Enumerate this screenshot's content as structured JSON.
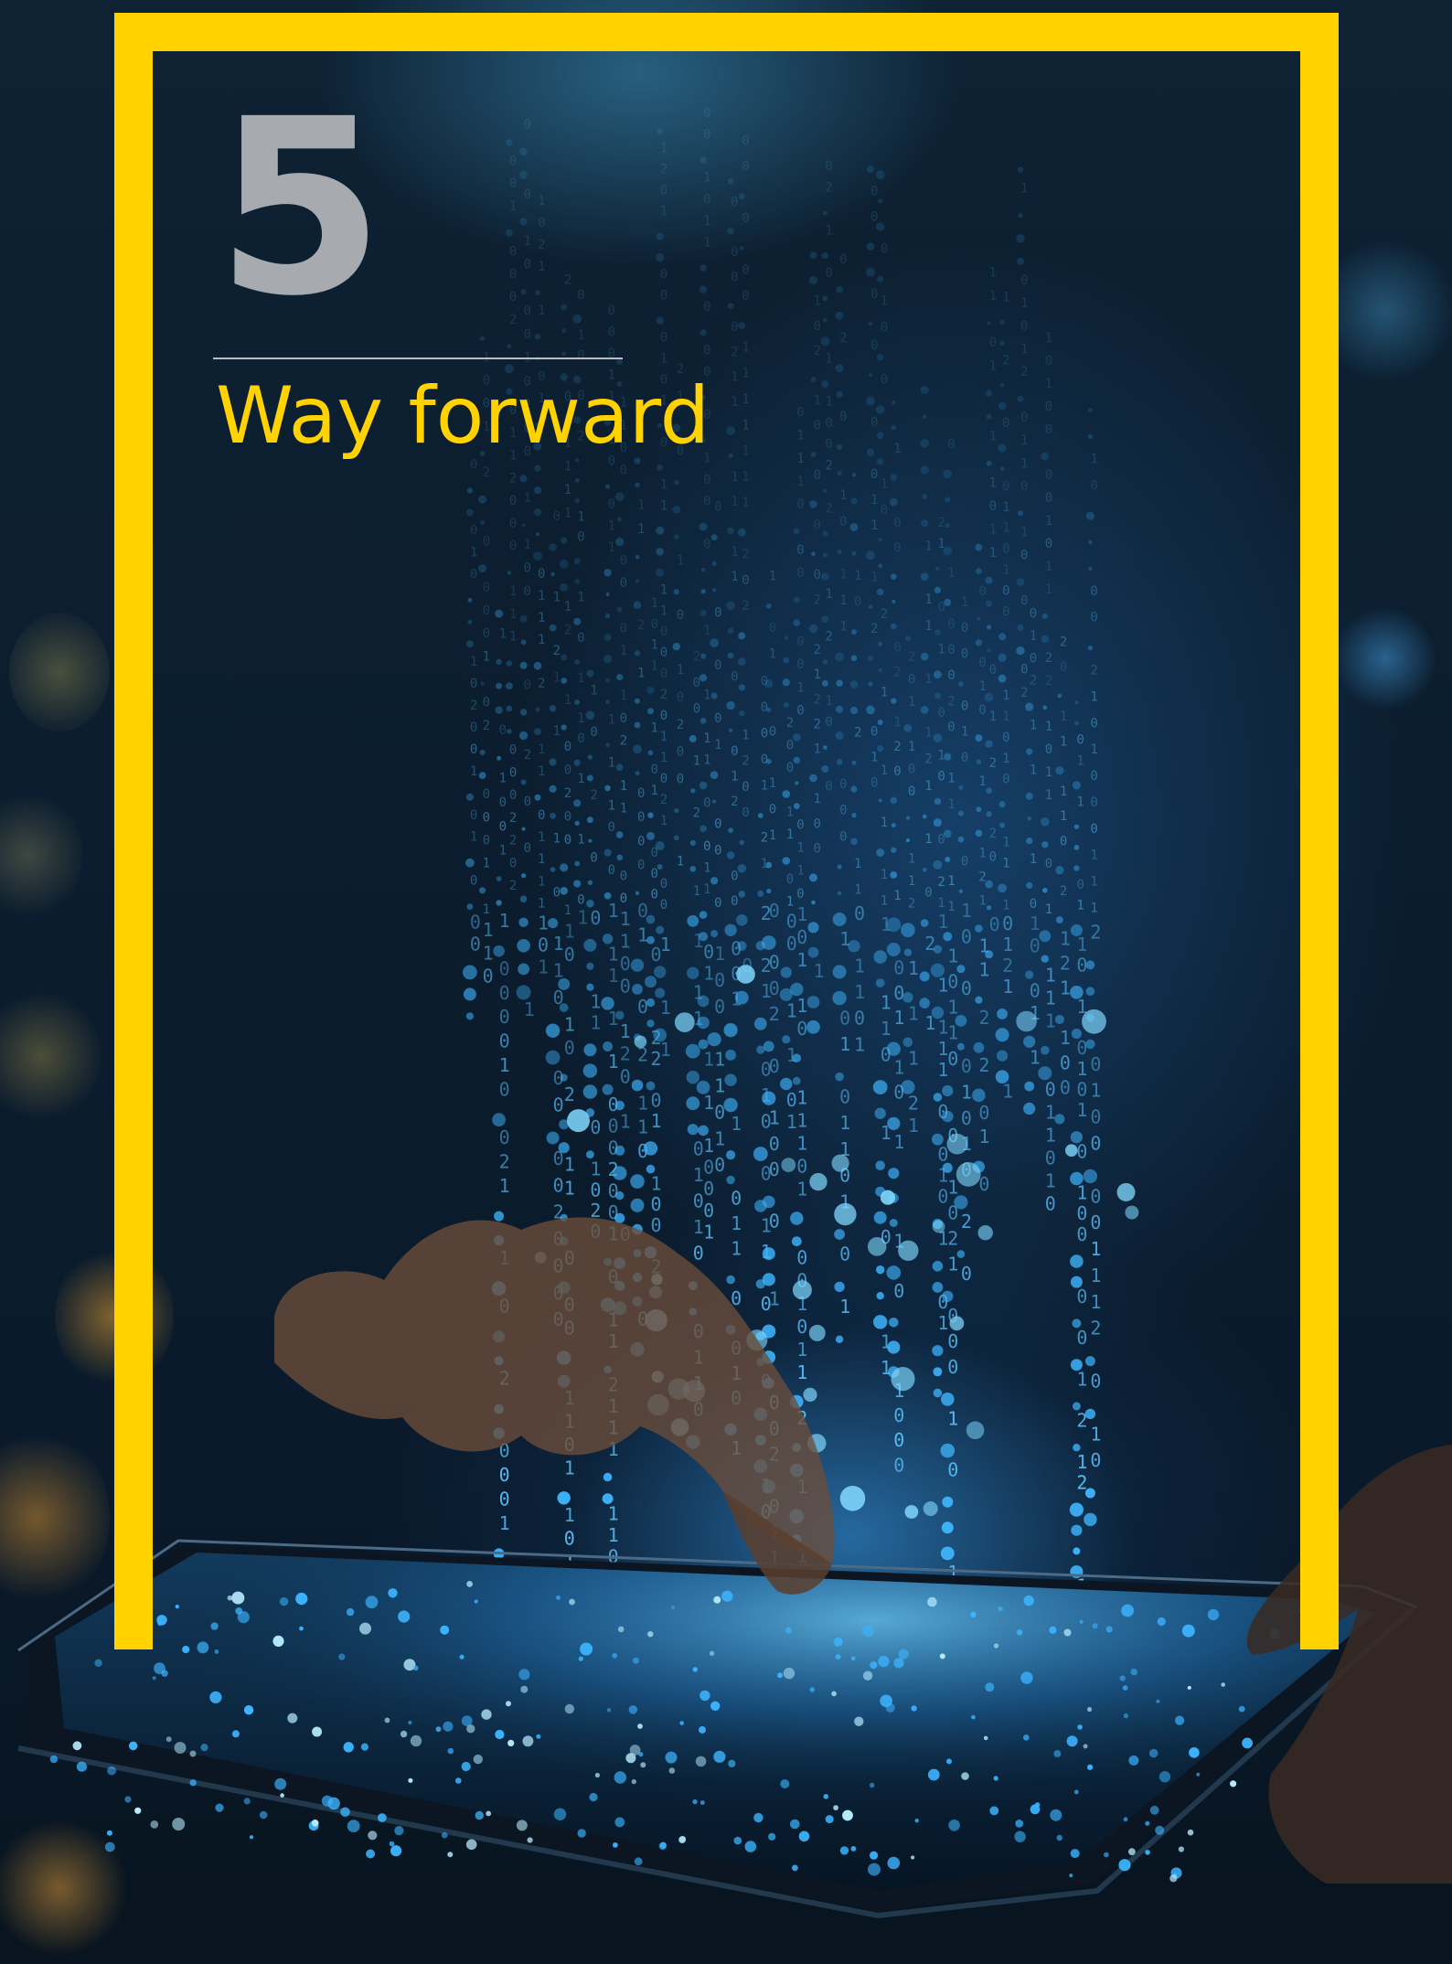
{
  "section": {
    "number": "5",
    "title": "Way forward"
  },
  "colors": {
    "frame": "#ffd200",
    "number": "#a7abb0",
    "title": "#ffd200",
    "divider": "#b9bcc0",
    "background": "#0b1d2e",
    "glow": "#3aaaff"
  },
  "photo": {
    "icon": "tablet-data-photo"
  }
}
